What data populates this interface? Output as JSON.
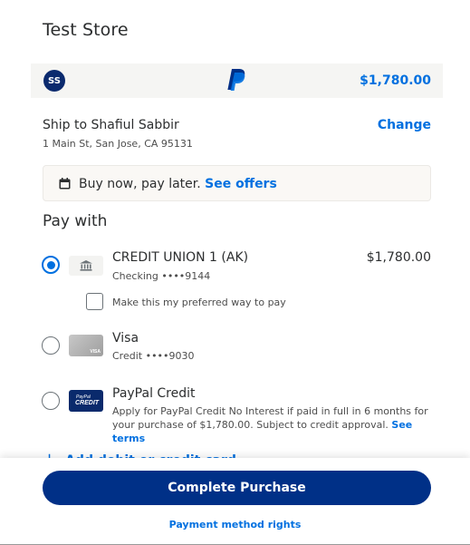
{
  "store": {
    "title": "Test Store"
  },
  "summary": {
    "avatar_initials": "SS",
    "logo_icon": "paypal-logo-icon",
    "total": "$1,780.00",
    "colors": {
      "accent": "#0070e0",
      "brand_dark": "#003087",
      "avatar": "#0b2a6e"
    }
  },
  "shipping": {
    "title": "Ship to Shafiul Sabbir",
    "address": "1 Main St, San Jose, CA 95131",
    "change_label": "Change"
  },
  "bnpl": {
    "icon": "calendar-icon",
    "text": "Buy now, pay later.",
    "link": "See offers"
  },
  "pay_with": {
    "heading": "Pay with",
    "options": [
      {
        "icon": "bank-icon",
        "name": "CREDIT UNION 1 (AK)",
        "sub": "Checking ••••9144",
        "amount": "$1,780.00",
        "selected": true,
        "preferred_label": "Make this my preferred way to pay"
      },
      {
        "icon": "visa-card-icon",
        "card_text": "VISA",
        "name": "Visa",
        "sub": "Credit ••••9030",
        "selected": false
      },
      {
        "icon": "paypal-credit-card-icon",
        "card_line1": "PayPal",
        "card_line2": "CREDIT",
        "name": "PayPal Credit",
        "desc": "Apply for PayPal Credit No Interest if paid in full in 6 months for your purchase of $1,780.00. Subject to credit approval.",
        "terms": "See terms",
        "selected": false
      }
    ],
    "add_card": "Add debit or credit card"
  },
  "footer": {
    "complete_button": "Complete Purchase",
    "rights_link": "Payment method rights"
  }
}
